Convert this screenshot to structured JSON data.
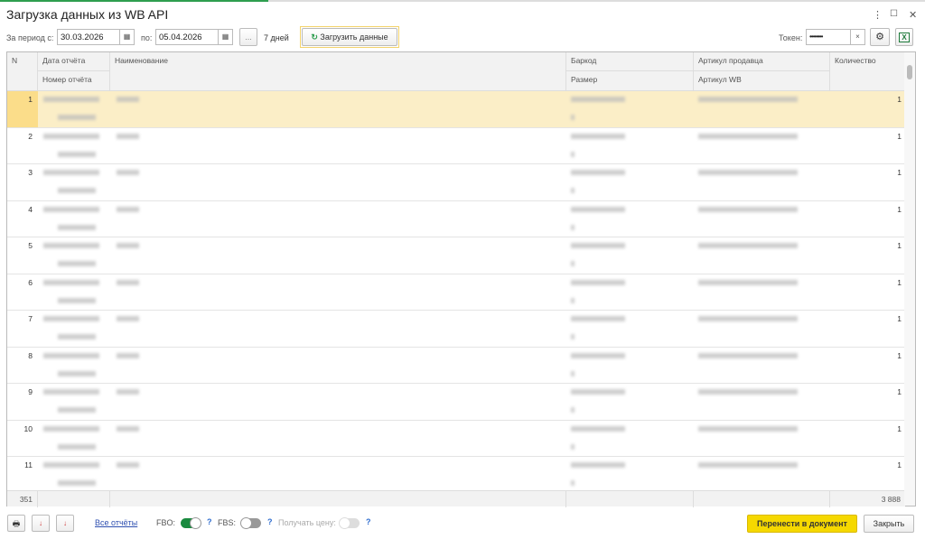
{
  "window": {
    "title": "Загрузка данных из WB API",
    "progress": 0.29
  },
  "toolbar": {
    "period_from_label": "За период с:",
    "date_from": "30.03.2026",
    "period_to_label": "по:",
    "date_to": "05.04.2026",
    "more_label": "...",
    "days_label": "7 дней",
    "load_label": "Загрузить данные",
    "token_label": "Токен:",
    "token_value": "••••••••",
    "clear_label": "×"
  },
  "table": {
    "headers": {
      "n": "N",
      "date": "Дата отчёта",
      "report_no": "Номер отчёта",
      "name": "Наименование",
      "barcode": "Баркод",
      "size": "Размер",
      "seller_article": "Артикул продавца",
      "wb_article": "Артикул WB",
      "qty": "Количество"
    },
    "rows": [
      {
        "n": "1",
        "qty": "1"
      },
      {
        "n": "2",
        "qty": "1"
      },
      {
        "n": "3",
        "qty": "1"
      },
      {
        "n": "4",
        "qty": "1"
      },
      {
        "n": "5",
        "qty": "1"
      },
      {
        "n": "6",
        "qty": "1"
      },
      {
        "n": "7",
        "qty": "1"
      },
      {
        "n": "8",
        "qty": "1"
      },
      {
        "n": "9",
        "qty": "1"
      },
      {
        "n": "10",
        "qty": "1"
      },
      {
        "n": "11",
        "qty": "1"
      }
    ],
    "footer": {
      "count": "351",
      "qty_total": "3 888"
    }
  },
  "bottom": {
    "all_reports": "Все отчёты",
    "fbo_label": "FBO:",
    "fbo_on": true,
    "fbs_label": "FBS:",
    "fbs_on": false,
    "price_label": "Получать цену:",
    "price_on": false,
    "help": "?",
    "transfer_label": "Перенести в документ",
    "close_label": "Закрыть"
  },
  "colors": {
    "accent_green": "#2e9e4f",
    "selected_row": "#fbeec7",
    "primary_button": "#f5d800"
  }
}
